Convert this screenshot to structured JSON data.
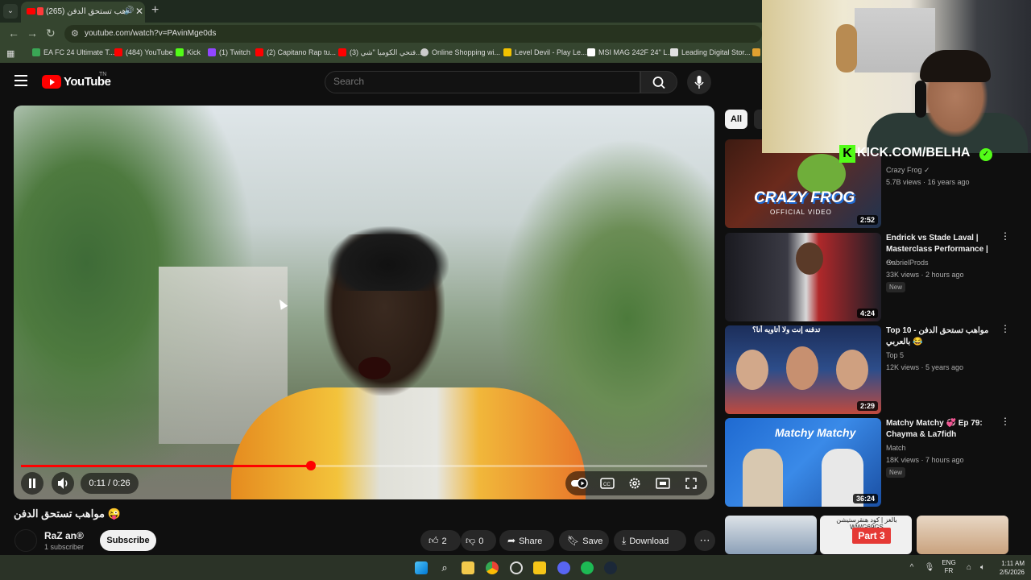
{
  "browser": {
    "tab": {
      "title": "مواهب تستحق الدفن (265)"
    },
    "url": "youtube.com/watch?v=PAvinMge0ds",
    "bookmarks": [
      {
        "label": "EA FC 24 Ultimate T...",
        "color": "#3aa655"
      },
      {
        "label": "(484) YouTube",
        "color": "#ff0000"
      },
      {
        "label": "Kick",
        "color": "#53fc18"
      },
      {
        "label": "(1) Twitch",
        "color": "#9146ff"
      },
      {
        "label": "(2) Capitano Rap tu...",
        "color": "#ff0000"
      },
      {
        "label": "(3) فتحي الكوميا \"شي...",
        "color": "#ff0000"
      },
      {
        "label": "Online Shopping wi...",
        "color": "#cccccc"
      },
      {
        "label": "Level Devil - Play Le...",
        "color": "#f2c200"
      },
      {
        "label": "MSI MAG 242F 24\" L...",
        "color": "#ffffff"
      },
      {
        "label": "Leading Digital Stor...",
        "color": "#e0e0e0"
      }
    ]
  },
  "youtube": {
    "logo": "YouTube",
    "logo_region": "TN",
    "search_placeholder": "Search"
  },
  "player": {
    "time_display": "0:11 / 0:26",
    "progress_fraction": 0.4231
  },
  "video": {
    "title": "مواهب تستحق الدفن 😜",
    "channel": "RaZ an®",
    "subscribers": "1 subscriber",
    "subscribe_label": "Subscribe",
    "likes": "2",
    "dislikes": "0",
    "share_label": "Share",
    "save_label": "Save",
    "download_label": "Download"
  },
  "sidebar": {
    "chip_all": "All",
    "recommendations": [
      {
        "title": "",
        "channel": "Crazy Frog ✓",
        "meta": "5.7B views · 16 years ago",
        "duration": "2:52",
        "new": "",
        "thumb_text": "CRAZY FROG",
        "thumb_sub": "OFFICIAL VIDEO"
      },
      {
        "title": "Endrick vs Stade Laval | Masterclass Performance | ...",
        "channel": "GabrielProds",
        "meta": "33K views · 2 hours ago",
        "duration": "4:24",
        "new": "New",
        "thumb_text": "",
        "thumb_sub": ""
      },
      {
        "title": "Top 10 - مواهب تستحق الدفن 😂 بالعربي",
        "channel": "Top 5",
        "meta": "12K views · 5 years ago",
        "duration": "2:29",
        "new": "",
        "thumb_text": "تدفنه إنت ولا أتاويه أنا؟",
        "thumb_sub": ""
      },
      {
        "title": "Matchy Matchy 💞 Ep 79: Chayma & La7fidh",
        "channel": "Match",
        "meta": "18K views · 7 hours ago",
        "duration": "36:24",
        "new": "New",
        "thumb_text": "Matchy Matchy",
        "thumb_sub": ""
      }
    ],
    "shorts_part": "Part 3",
    "shorts_caption": "بالغز | كود هنقرستيشن WWG69GS"
  },
  "overlay": {
    "kick_text": "KICK.COM/BELHA"
  },
  "taskbar": {
    "lang_line1": "ENG",
    "lang_line2": "FR",
    "time": "1:11 AM",
    "date": "2/5/2026"
  }
}
